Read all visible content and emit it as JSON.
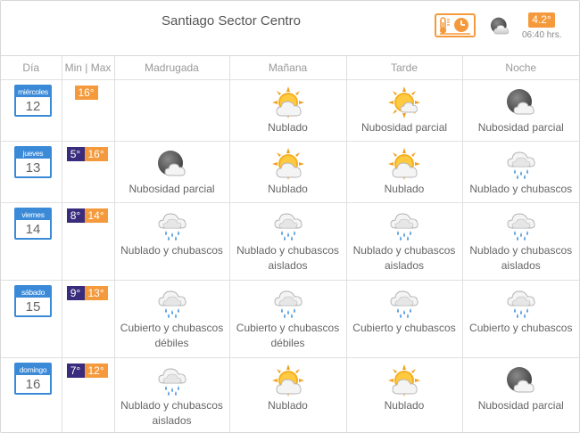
{
  "header": {
    "title": "Santiago Sector Centro",
    "current_temp": "4.2°",
    "current_time": "06:40 hrs.",
    "current_icon": "partly-cloudy-night-icon"
  },
  "columns": {
    "day": "Día",
    "minmax": "Min | Max",
    "madrugada": "Madrugada",
    "manana": "Mañana",
    "tarde": "Tarde",
    "noche": "Noche"
  },
  "days": [
    {
      "name": "miércoles",
      "num": "12",
      "min": "",
      "max": "16°",
      "madrugada": {
        "icon": "",
        "text": ""
      },
      "manana": {
        "icon": "cloudy-sun-icon",
        "text": "Nublado"
      },
      "tarde": {
        "icon": "partly-cloudy-sun-icon",
        "text": "Nubosidad parcial"
      },
      "noche": {
        "icon": "partly-cloudy-night-icon",
        "text": "Nubosidad parcial"
      }
    },
    {
      "name": "jueves",
      "num": "13",
      "min": "5°",
      "max": "16°",
      "madrugada": {
        "icon": "partly-cloudy-night-icon",
        "text": "Nubosidad parcial"
      },
      "manana": {
        "icon": "cloudy-sun-icon",
        "text": "Nublado"
      },
      "tarde": {
        "icon": "cloudy-sun-icon",
        "text": "Nublado"
      },
      "noche": {
        "icon": "rain-cloud-icon",
        "text": "Nublado y chubascos"
      }
    },
    {
      "name": "viernes",
      "num": "14",
      "min": "8°",
      "max": "14°",
      "madrugada": {
        "icon": "rain-cloud-icon",
        "text": "Nublado y chubascos"
      },
      "manana": {
        "icon": "rain-cloud-icon",
        "text": "Nublado y chubascos aislados"
      },
      "tarde": {
        "icon": "rain-cloud-icon",
        "text": "Nublado y chubascos aislados"
      },
      "noche": {
        "icon": "rain-cloud-icon",
        "text": "Nublado y chubascos aislados"
      }
    },
    {
      "name": "sábado",
      "num": "15",
      "min": "9°",
      "max": "13°",
      "madrugada": {
        "icon": "rain-cloud-icon",
        "text": "Cubierto y chubascos débiles"
      },
      "manana": {
        "icon": "rain-cloud-icon",
        "text": "Cubierto y chubascos débiles"
      },
      "tarde": {
        "icon": "rain-cloud-icon",
        "text": "Cubierto y chubascos"
      },
      "noche": {
        "icon": "rain-cloud-icon",
        "text": "Cubierto y chubascos"
      }
    },
    {
      "name": "domingo",
      "num": "16",
      "min": "7°",
      "max": "12°",
      "madrugada": {
        "icon": "rain-cloud-icon",
        "text": "Nublado y chubascos aislados"
      },
      "manana": {
        "icon": "cloudy-sun-icon",
        "text": "Nublado"
      },
      "tarde": {
        "icon": "cloudy-sun-icon",
        "text": "Nublado"
      },
      "noche": {
        "icon": "partly-cloudy-night-icon",
        "text": "Nubosidad parcial"
      }
    }
  ],
  "colors": {
    "accent": "#f59a3c",
    "min_badge": "#3a2c7c",
    "date_blue": "#3a8ad8"
  }
}
